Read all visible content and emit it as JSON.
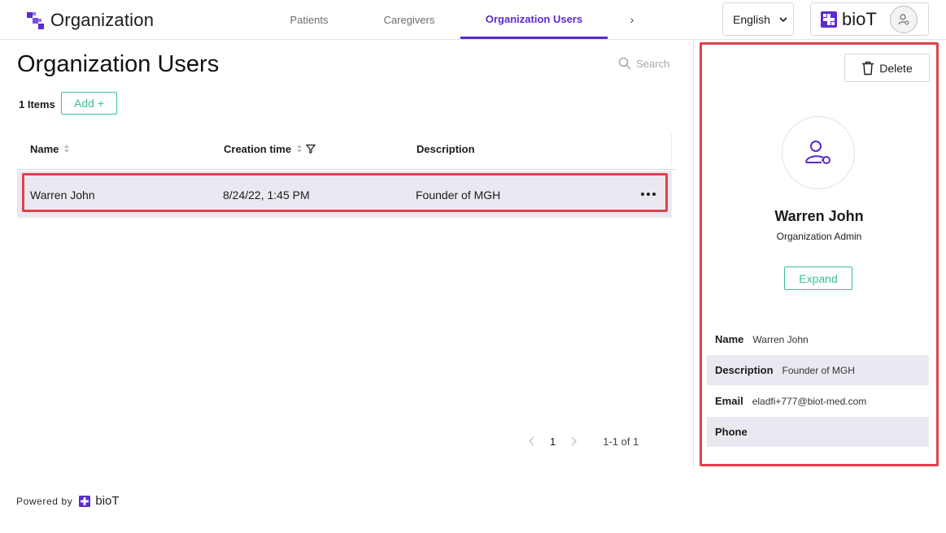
{
  "header": {
    "org_title": "Organization",
    "tabs": [
      {
        "label": "Patients"
      },
      {
        "label": "Caregivers"
      },
      {
        "label": "Organization Users"
      }
    ],
    "more_glyph": "›",
    "language": "English",
    "brand": "bioT"
  },
  "main": {
    "title": "Organization Users",
    "search_placeholder": "Search",
    "items_count": "1 Items",
    "add_label": "Add +",
    "table": {
      "columns": [
        "Name",
        "Creation time",
        "Description"
      ],
      "rows": [
        {
          "name": "Warren John",
          "creation_time": "8/24/22, 1:45 PM",
          "description": "Founder of MGH"
        }
      ]
    },
    "pagination": {
      "current": "1",
      "range": "1-1 of 1"
    }
  },
  "footer": {
    "powered_by": "Powered by",
    "brand": "bioT"
  },
  "panel": {
    "delete_label": "Delete",
    "user_name": "Warren John",
    "user_role": "Organization Admin",
    "expand_label": "Expand",
    "details": [
      {
        "key": "Name",
        "value": "Warren John"
      },
      {
        "key": "Description",
        "value": "Founder of MGH"
      },
      {
        "key": "Email",
        "value": "eladfi+777@biot-med.com"
      },
      {
        "key": "Phone",
        "value": ""
      }
    ]
  },
  "colors": {
    "brand_purple": "#5b2ad0",
    "accent_green": "#3bbf9a",
    "highlight_red": "#e0414b",
    "row_selected": "#ece8f1"
  }
}
